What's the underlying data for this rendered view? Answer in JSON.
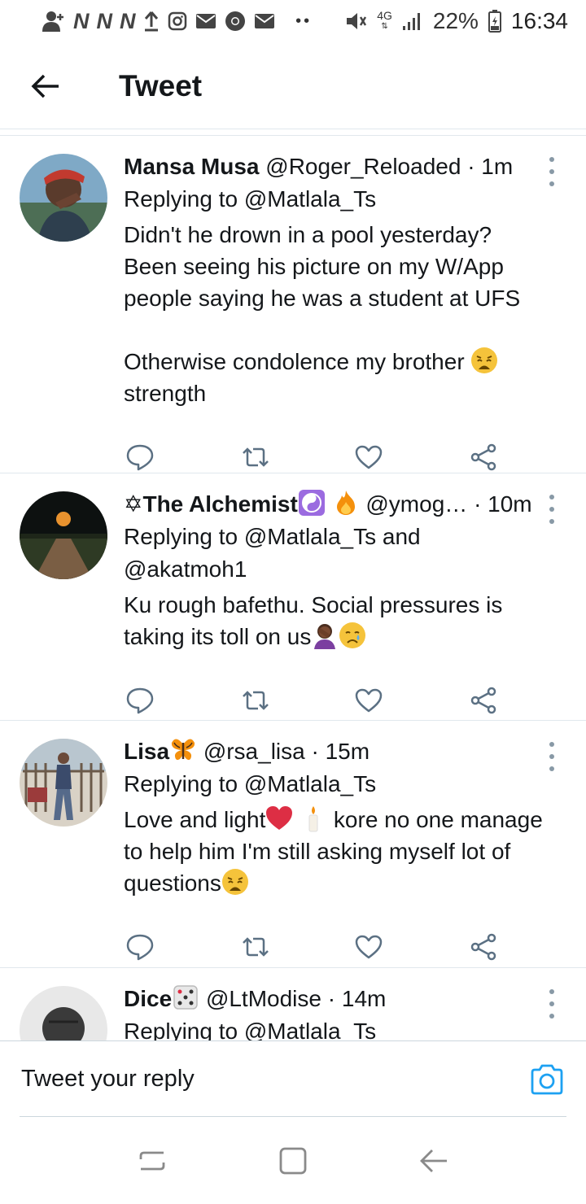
{
  "status_bar": {
    "network_letters": [
      "N",
      "N",
      "N"
    ],
    "network_type": "4G",
    "battery": "22%",
    "time": "16:34"
  },
  "header": {
    "title": "Tweet"
  },
  "accent_color": "#1da1f2",
  "tweets": [
    {
      "name": "Mansa Musa",
      "handle": "@Roger_Reloaded",
      "time": "· 1m",
      "replying": "Replying to @Matlala_Ts",
      "text_1": "Didn't he drown in a pool yesterday? Been seeing his picture on my W/App people saying he was a student at UFS",
      "text_2": "Otherwise condolence my brother ",
      "text_3": "strength"
    },
    {
      "name": "✡The Alchemist",
      "handle": "@ymog…",
      "time": "· 10m",
      "replying": "Replying to @Matlala_Ts and @akatmoh1",
      "text_1": "Ku rough bafethu. Social pressures is taking its toll on us"
    },
    {
      "name": "Lisa",
      "handle": "@rsa_lisa",
      "time": "· 15m",
      "replying": "Replying to @Matlala_Ts",
      "text_1": "Love and light",
      "text_2": " kore no one manage to help him I'm still asking myself lot of questions"
    },
    {
      "name": "Dice",
      "handle": "@LtModise",
      "time": "· 14m",
      "replying": "Replying to @Matlala_Ts"
    }
  ],
  "reply_bar": {
    "placeholder": "Tweet your reply"
  }
}
